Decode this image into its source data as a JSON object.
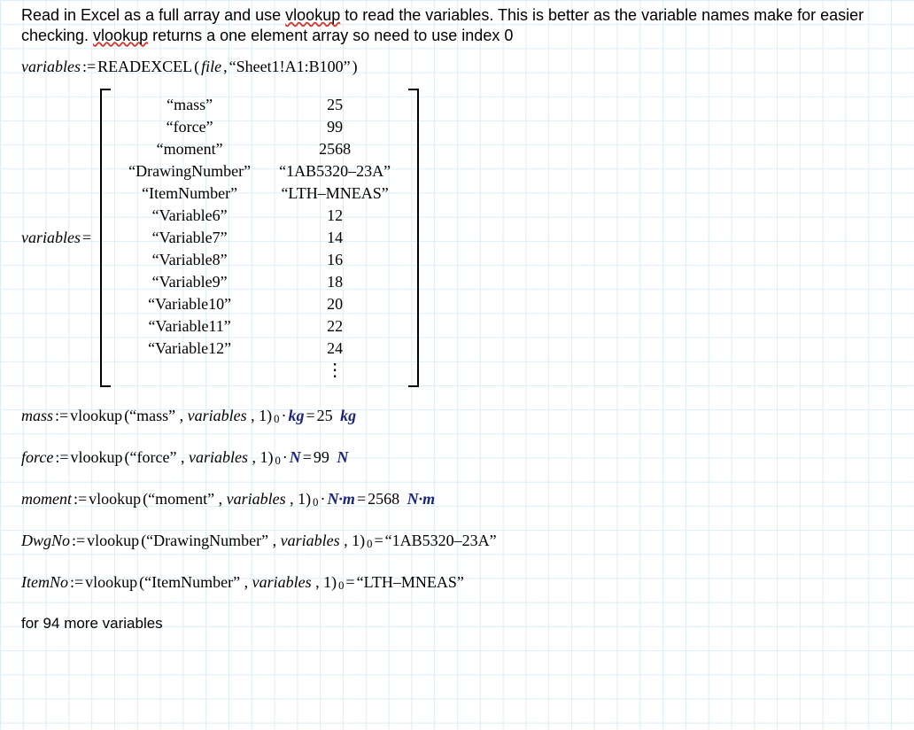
{
  "intro": {
    "part1": "Read in Excel as a full array and use ",
    "vlookup1": "vlookup",
    "part2": " to read the variables.  This is better as the variable names make for easier checking.  ",
    "vlookup2": "vlookup",
    "part3": " returns a one element array so need to use index 0"
  },
  "readexcel": {
    "lhs": "variables",
    "assign": ":=",
    "func": "READEXCEL",
    "arg_file": "file",
    "comma": ", ",
    "arg_range": "“Sheet1!A1:B100”"
  },
  "matrix": {
    "lhs": "variables",
    "eq": "=",
    "rows": [
      {
        "name": "“mass”",
        "val": "25"
      },
      {
        "name": "“force”",
        "val": "99"
      },
      {
        "name": "“moment”",
        "val": "2568"
      },
      {
        "name": "“DrawingNumber”",
        "val": "“1AB5320–23A”"
      },
      {
        "name": "“ItemNumber”",
        "val": "“LTH–MNEAS”"
      },
      {
        "name": "“Variable6”",
        "val": "12"
      },
      {
        "name": "“Variable7”",
        "val": "14"
      },
      {
        "name": "“Variable8”",
        "val": "16"
      },
      {
        "name": "“Variable9”",
        "val": "18"
      },
      {
        "name": "“Variable10”",
        "val": "20"
      },
      {
        "name": "“Variable11”",
        "val": "22"
      },
      {
        "name": "“Variable12”",
        "val": "24"
      }
    ],
    "vdots": "⋮"
  },
  "lines": {
    "mass": {
      "var": "mass",
      "assign": ":=",
      "func": "vlookup",
      "args": "(“mass” , variables , 1)",
      "sub": "0",
      "dot": "·",
      "unit": "kg",
      "eq": "=",
      "val": "25",
      "unit2": "kg"
    },
    "force": {
      "var": "force",
      "assign": ":=",
      "func": "vlookup",
      "args": "(“force” , variables , 1)",
      "sub": "0",
      "dot": "·",
      "unit": "N",
      "eq": "=",
      "val": "99",
      "unit2": "N"
    },
    "moment": {
      "var": "moment",
      "assign": ":=",
      "func": "vlookup",
      "args": "(“moment” , variables , 1)",
      "sub": "0",
      "dot": "·",
      "unit": "N·m",
      "eq": "=",
      "val": "2568",
      "unit2": "N·m"
    },
    "dwgno": {
      "var": "DwgNo",
      "assign": ":=",
      "func": "vlookup",
      "args": "(“DrawingNumber” , variables , 1)",
      "sub": "0",
      "eq": "=",
      "val": "“1AB5320–23A”"
    },
    "itemno": {
      "var": "ItemNo",
      "assign": ":=",
      "func": "vlookup",
      "args": "(“ItemNumber” , variables , 1)",
      "sub": "0",
      "eq": "=",
      "val": "“LTH–MNEAS”"
    }
  },
  "footer": "for 94 more variables"
}
